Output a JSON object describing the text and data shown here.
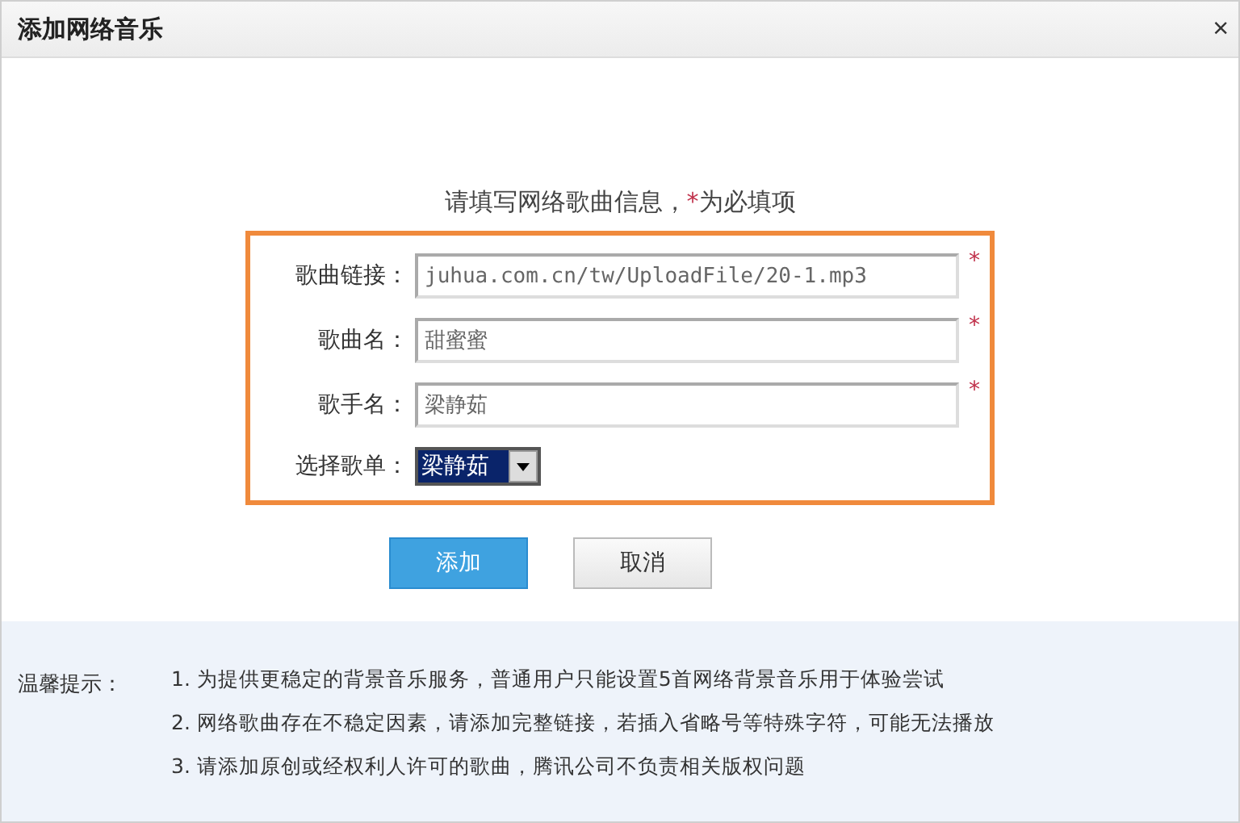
{
  "window": {
    "title": "添加网络音乐",
    "close": "×"
  },
  "instruction": {
    "text": "请填写网络歌曲信息，",
    "star": "*",
    "suffix": "为必填项"
  },
  "fields": [
    {
      "kind": "text",
      "label": "歌曲链接：",
      "value": "juhua.com.cn/tw/UploadFile/20-1.mp3",
      "required": true
    },
    {
      "kind": "text",
      "label": "歌曲名：",
      "value": "甜蜜蜜",
      "required": true
    },
    {
      "kind": "text",
      "label": "歌手名：",
      "value": "梁静茹",
      "required": true
    },
    {
      "kind": "select",
      "label": "选择歌单：",
      "value": "梁静茹",
      "required": false
    }
  ],
  "buttons": [
    {
      "label": "添加",
      "primary": true
    },
    {
      "label": "取消",
      "primary": false
    }
  ],
  "tips": {
    "label": "温馨提示：",
    "items": [
      "1. 为提供更稳定的背景音乐服务，普通用户只能设置5首网络背景音乐用于体验尝试",
      "2. 网络歌曲存在不稳定因素，请添加完整链接，若插入省略号等特殊字符，可能无法播放",
      "3. 请添加原创或经权利人许可的歌曲，腾讯公司不负责相关版权问题"
    ]
  }
}
